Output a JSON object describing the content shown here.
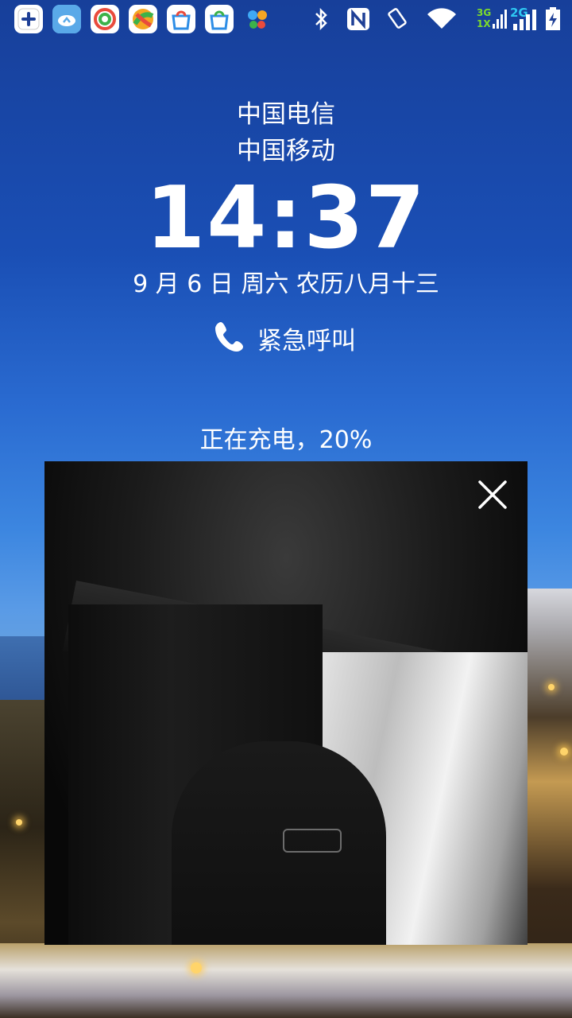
{
  "status_bar": {
    "apps": [
      {
        "icon": "add-icon",
        "color": "#ffffff"
      },
      {
        "icon": "cloud-storage-icon",
        "color": "#5aa9e8"
      },
      {
        "icon": "swirl-app-icon",
        "color": "#ffffff"
      },
      {
        "icon": "color-ball-app-icon",
        "color": "#f5a623"
      },
      {
        "icon": "cloud-bag-icon",
        "color": "#ffffff"
      },
      {
        "icon": "cloud-bag-alt-icon",
        "color": "#ffffff"
      },
      {
        "icon": "butterfly-app-icon",
        "color": "#3fa9f5"
      }
    ],
    "network_left_top": "3G",
    "network_left_bottom": "1X",
    "network_right": "2G",
    "indicator_colors": {
      "green": "#7ddb2b",
      "cyan": "#2ec8f2"
    }
  },
  "lock_screen": {
    "carrier_1": "中国电信",
    "carrier_2": "中国移动",
    "time": "14:37",
    "date": "9 月 6 日 周六   农历八月十三",
    "emergency_call": "紧急呼叫",
    "charging_status": "正在充电，20%"
  },
  "camera_preview": {
    "close_icon": "close-icon"
  }
}
